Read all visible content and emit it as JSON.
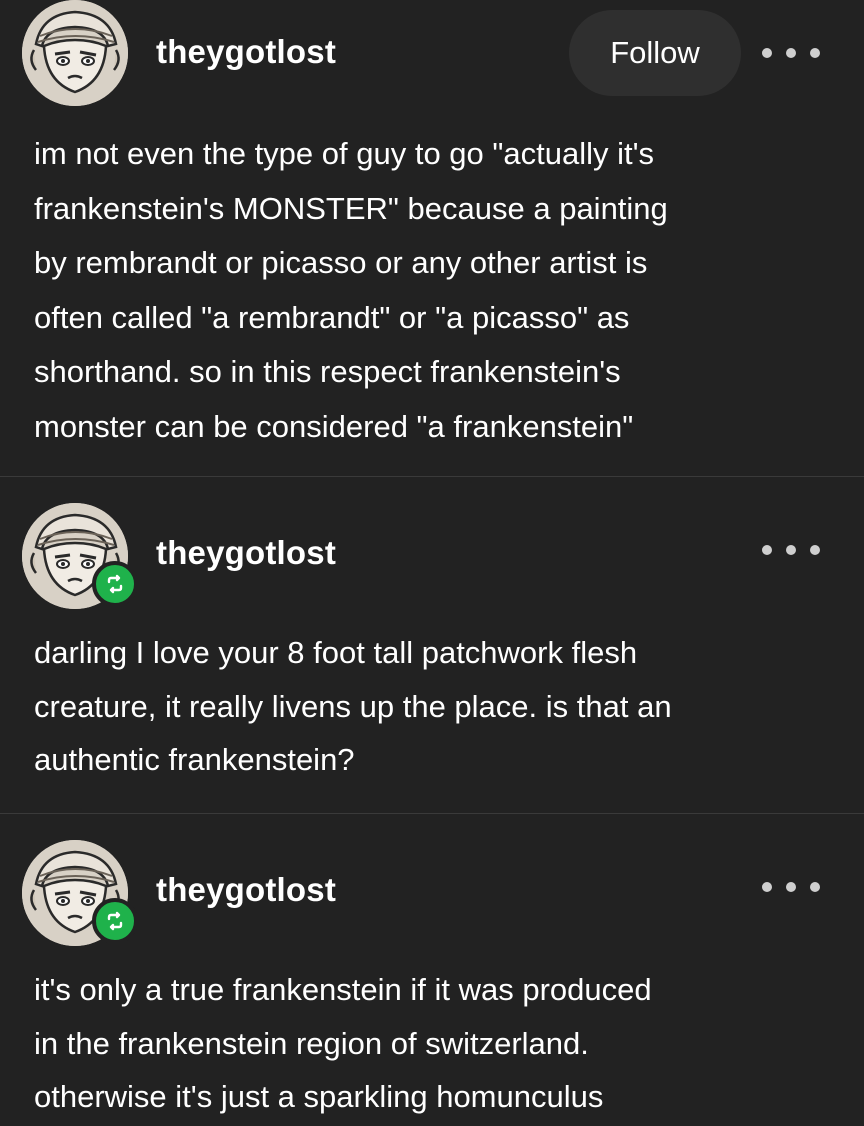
{
  "posts": [
    {
      "username": "theygotlost",
      "follow_label": "Follow",
      "avatar": "avatar-icon",
      "more_icon": "more-options-icon",
      "body": "im not even the type of guy to go \"actually it's\nfrankenstein's MONSTER\" because a painting\nby rembrandt or picasso or any other artist is\noften called \"a rembrandt\" or \"a picasso\" as\nshorthand. so in this respect frankenstein's\nmonster can be considered \"a frankenstein\""
    },
    {
      "username": "theygotlost",
      "avatar": "avatar-icon",
      "badge_icon": "reblog-icon",
      "more_icon": "more-options-icon",
      "body": "darling I love your 8 foot tall patchwork flesh\ncreature, it really livens up the place. is that an\nauthentic frankenstein?"
    },
    {
      "username": "theygotlost",
      "avatar": "avatar-icon",
      "badge_icon": "reblog-icon",
      "more_icon": "more-options-icon",
      "body": "it's only a true frankenstein if it was produced\nin the frankenstein region of switzerland.\notherwise it's just a sparkling homunculus"
    }
  ],
  "colors": {
    "background": "#222222",
    "text": "#ffffff",
    "follow_button_bg": "#2f2f2f",
    "reblog_badge": "#1fb24b",
    "divider": "#3a3a3a"
  }
}
